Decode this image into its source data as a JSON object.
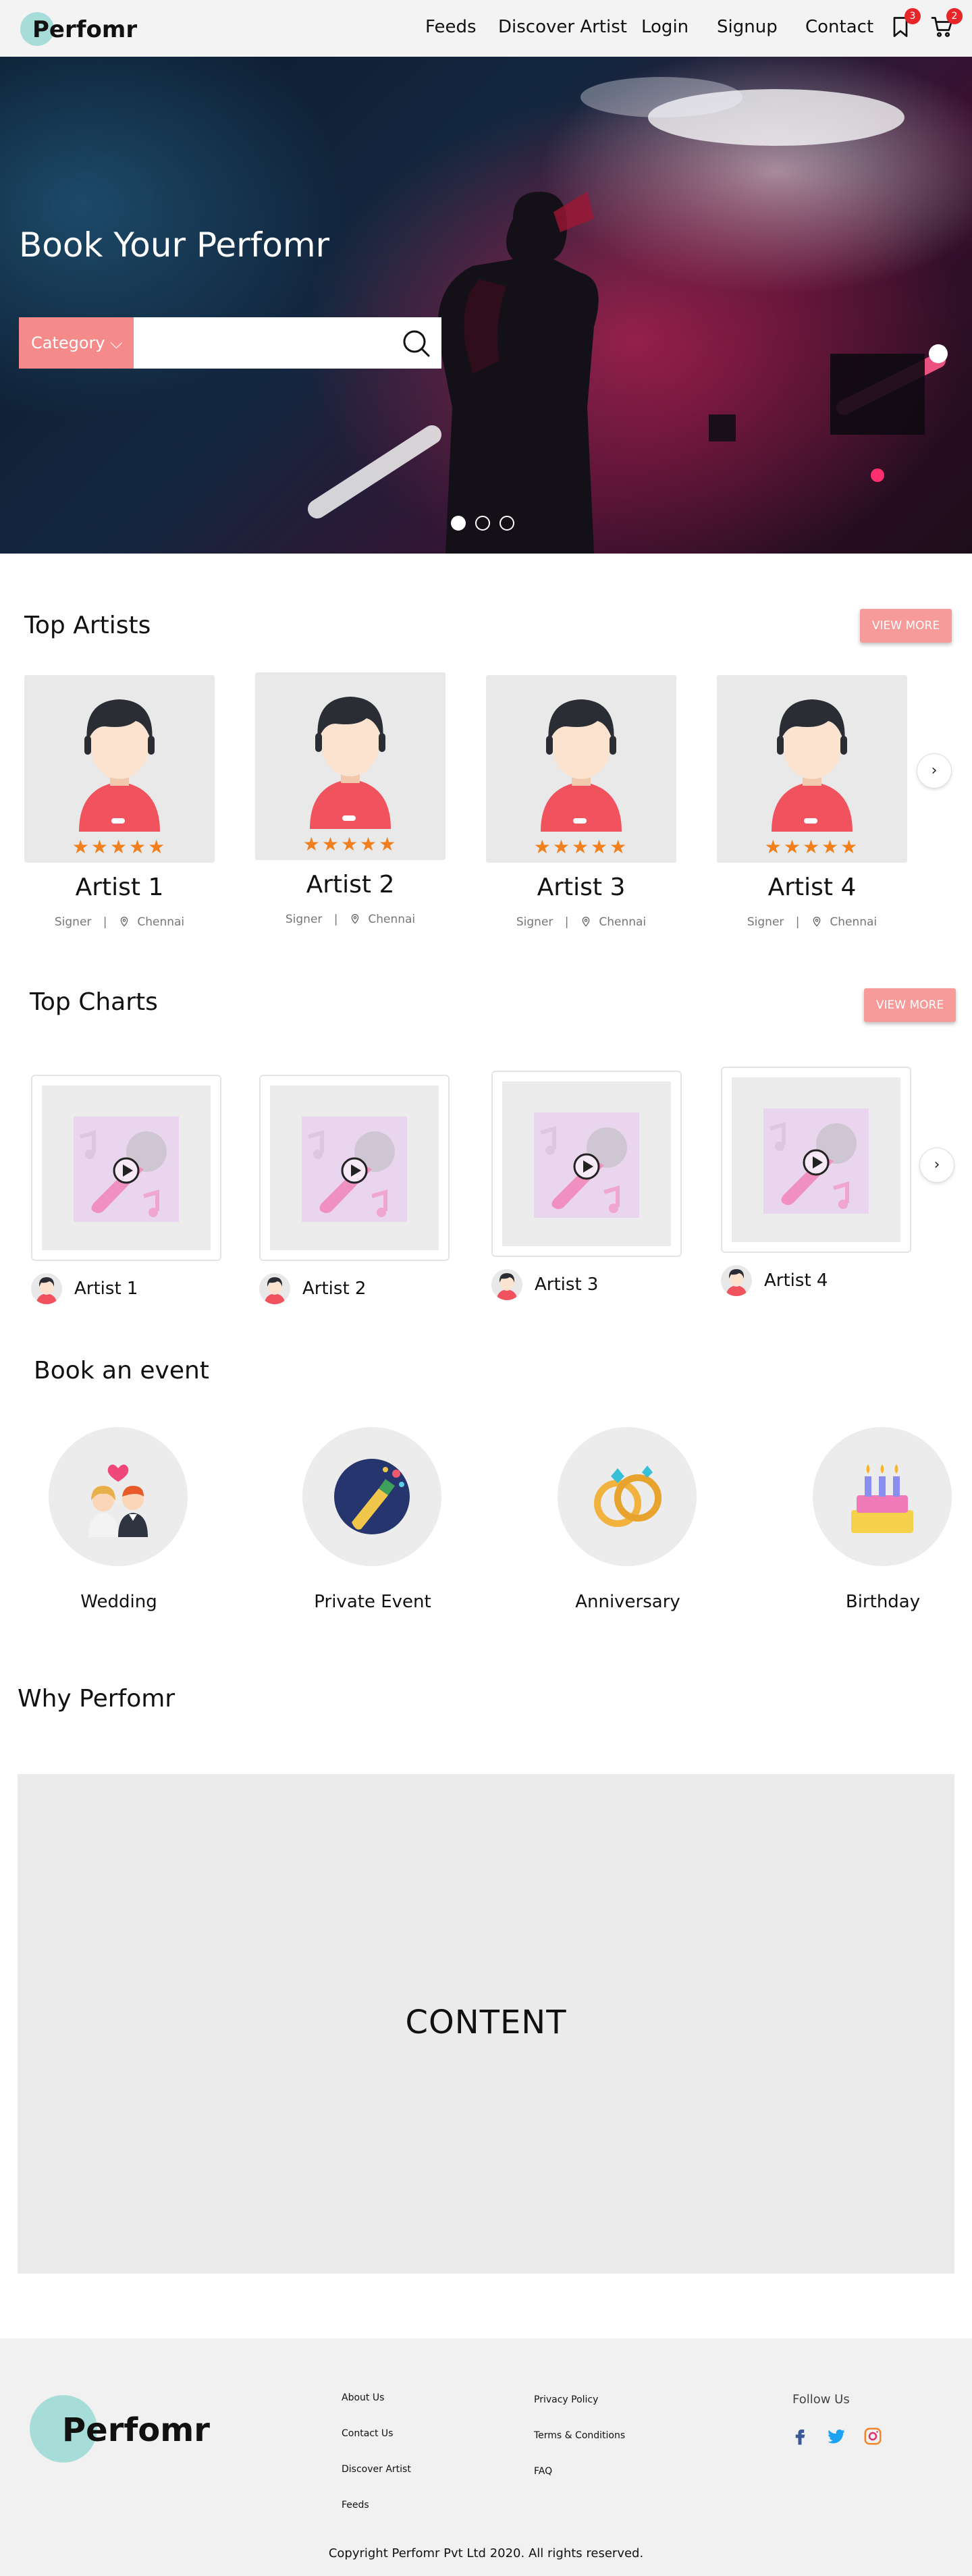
{
  "brand": {
    "logo_text": "Perfomr",
    "accent": "#f48a8a",
    "logo_bg": "#a7ddd8"
  },
  "nav": {
    "links": [
      "Feeds",
      "Discover Artist",
      "Login",
      "Signup",
      "Contact"
    ],
    "bookmark_badge": "3",
    "cart_badge": "2",
    "icons": [
      "bookmark-icon",
      "cart-icon"
    ]
  },
  "hero": {
    "title": "Book Your Perfomr",
    "category_label": "Category ⌵",
    "search_placeholder": "",
    "slides": 3,
    "active_slide": 1
  },
  "top_artists": {
    "title": "Top Artists",
    "view_more": "VIEW MORE",
    "items": [
      {
        "name": "Artist 1",
        "role": "Signer",
        "location": "Chennai",
        "rating": "★★★★★"
      },
      {
        "name": "Artist 2",
        "role": "Signer",
        "location": "Chennai",
        "rating": "★★★★★"
      },
      {
        "name": "Artist 3",
        "role": "Signer",
        "location": "Chennai",
        "rating": "★★★★★"
      },
      {
        "name": "Artist 4",
        "role": "Signer",
        "location": "Chennai",
        "rating": "★★★★★"
      }
    ]
  },
  "top_charts": {
    "title": "Top Charts",
    "view_more": "VIEW MORE",
    "items": [
      {
        "artist": "Artist 1"
      },
      {
        "artist": "Artist 2"
      },
      {
        "artist": "Artist 3"
      },
      {
        "artist": "Artist 4"
      }
    ]
  },
  "events": {
    "title": "Book an event",
    "items": [
      {
        "label": "Wedding",
        "icon": "wedding-couple-icon"
      },
      {
        "label": "Private Event",
        "icon": "champagne-icon"
      },
      {
        "label": "Anniversary",
        "icon": "rings-icon"
      },
      {
        "label": "Birthday",
        "icon": "cake-icon"
      }
    ]
  },
  "why": {
    "title": "Why Perfomr",
    "content": "CONTENT"
  },
  "footer": {
    "logo_text": "Perfomr",
    "col1": [
      "About Us",
      "Contact Us",
      "Discover Artist",
      "Feeds"
    ],
    "col2": [
      "Privacy Policy",
      "Terms & Conditions",
      "FAQ"
    ],
    "follow_title": "Follow Us",
    "social": [
      "facebook-icon",
      "twitter-icon",
      "instagram-icon"
    ],
    "copyright": "Copyright Perfomr Pvt Ltd 2020. All rights reserved."
  }
}
